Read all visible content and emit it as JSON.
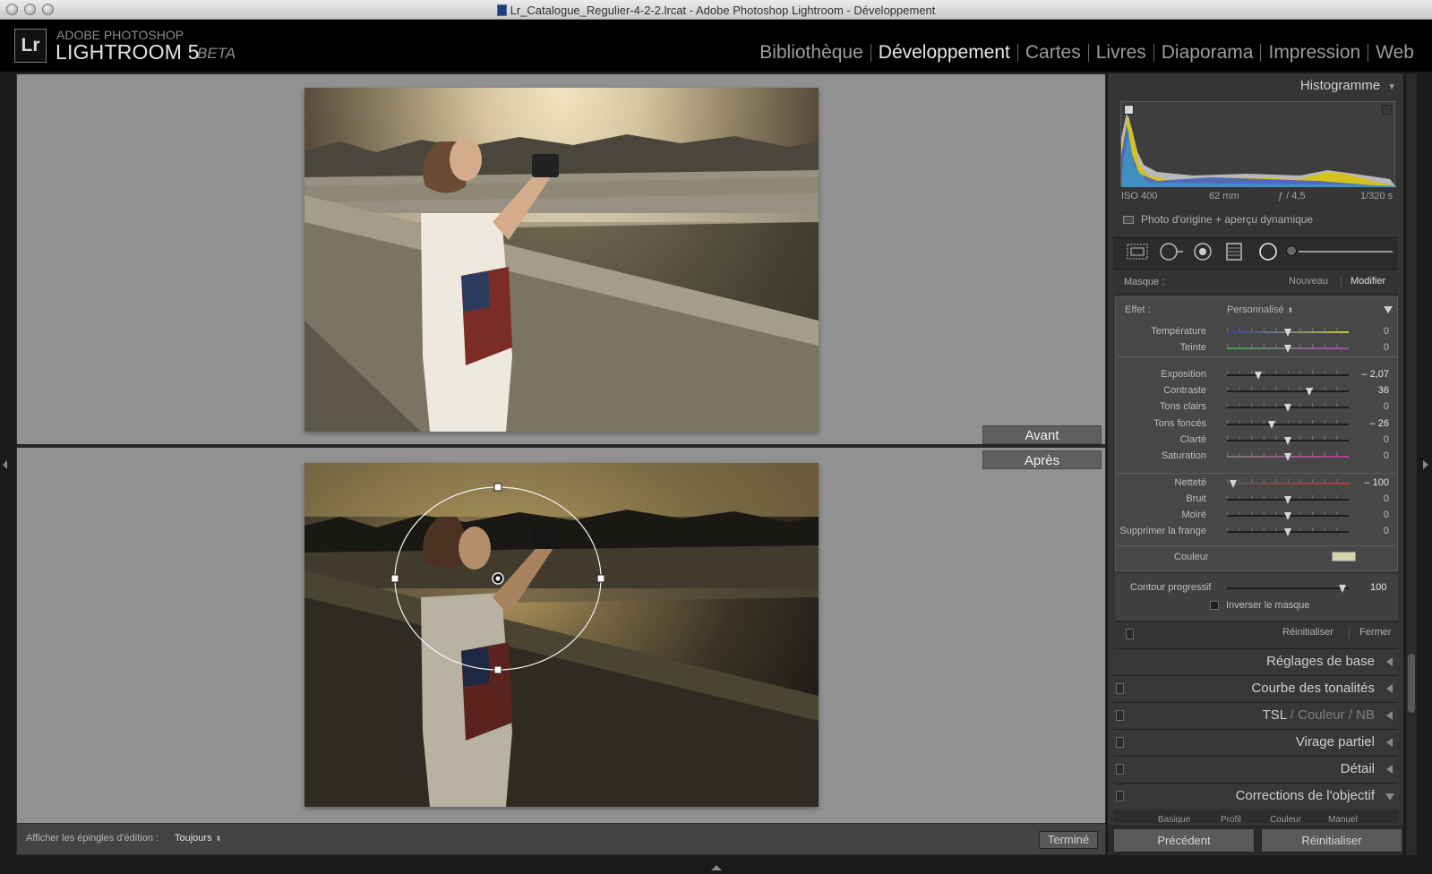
{
  "window": {
    "title": "Lr_Catalogue_Regulier-4-2-2.lrcat - Adobe Photoshop Lightroom - Développement"
  },
  "app": {
    "logo": "Lr",
    "brand_small": "ADOBE PHOTOSHOP",
    "brand_main": "LIGHTROOM 5",
    "brand_beta": "BETA"
  },
  "modules": [
    "Bibliothèque",
    "Développement",
    "Cartes",
    "Livres",
    "Diaporama",
    "Impression",
    "Web"
  ],
  "active_module": "Développement",
  "view": {
    "before_label": "Avant",
    "after_label": "Après"
  },
  "toolbar": {
    "pins_label": "Afficher les épingles d'édition :",
    "pins_value": "Toujours",
    "done_label": "Terminé"
  },
  "histogram": {
    "title": "Histogramme",
    "iso": "ISO 400",
    "focal": "62 mm",
    "aperture": "ƒ / 4,5",
    "shutter": "1/320 s",
    "original_toggle": "Photo d'origine + aperçu dynamique"
  },
  "mask": {
    "label": "Masque :",
    "new_label": "Nouveau",
    "edit_label": "Modifier",
    "effect_label": "Effet :",
    "effect_value": "Personnalisé",
    "sliders": [
      {
        "label": "Température",
        "value": "0",
        "pos": 0.5,
        "track": "temp"
      },
      {
        "label": "Teinte",
        "value": "0",
        "pos": 0.5,
        "track": "tint"
      },
      {
        "label": "Exposition",
        "value": "– 2,07",
        "pos": 0.26,
        "track": "plain"
      },
      {
        "label": "Contraste",
        "value": "36",
        "pos": 0.68,
        "track": "plain"
      },
      {
        "label": "Tons clairs",
        "value": "0",
        "pos": 0.5,
        "track": "plain"
      },
      {
        "label": "Tons foncés",
        "value": "– 26",
        "pos": 0.37,
        "track": "plain"
      },
      {
        "label": "Clarté",
        "value": "0",
        "pos": 0.5,
        "track": "plain"
      },
      {
        "label": "Saturation",
        "value": "0",
        "pos": 0.5,
        "track": "sat"
      },
      {
        "label": "Netteté",
        "value": "– 100",
        "pos": 0.05,
        "track": "sharp"
      },
      {
        "label": "Bruit",
        "value": "0",
        "pos": 0.5,
        "track": "plain"
      },
      {
        "label": "Moiré",
        "value": "0",
        "pos": 0.5,
        "track": "plain"
      },
      {
        "label": "Supprimer la frange",
        "value": "0",
        "pos": 0.5,
        "track": "plain"
      }
    ],
    "color_label": "Couleur",
    "color_swatch": "#d6d4a9",
    "feather_label": "Contour progressif",
    "feather_value": "100",
    "feather_pos": 0.95,
    "invert_label": "Inverser le masque",
    "reset_label": "Réinitialiser",
    "close_label": "Fermer"
  },
  "sections": [
    {
      "name": "Réglages de base"
    },
    {
      "name": "Courbe des tonalités"
    },
    {
      "name_tsl": "TSL",
      "name_couleur": "Couleur",
      "name_nb": "NB"
    },
    {
      "name": "Virage partiel"
    },
    {
      "name": "Détail"
    },
    {
      "name": "Corrections de l'objectif"
    }
  ],
  "lens_tabs": [
    "Basique",
    "Profil",
    "Couleur",
    "Manuel"
  ],
  "bottom_buttons": {
    "previous": "Précédent",
    "reset": "Réinitialiser"
  },
  "colors": {
    "accent_swatch": "#d6d4a9",
    "panel": "#353535",
    "viewport": "#919191"
  }
}
